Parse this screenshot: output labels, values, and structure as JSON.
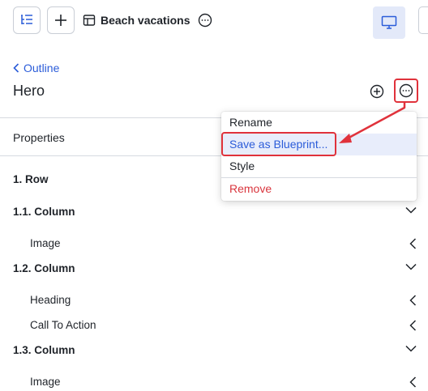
{
  "header": {
    "document_title": "Beach vacations",
    "icons": [
      "outline-tree-icon",
      "plus-icon",
      "template-icon",
      "more-icon",
      "desktop-icon"
    ]
  },
  "nav": {
    "back_label": "Outline"
  },
  "component": {
    "title": "Hero"
  },
  "section": {
    "properties_label": "Properties"
  },
  "tree": {
    "items": [
      {
        "label": "1. Row"
      },
      {
        "label": "1.1. Column"
      },
      {
        "label": "Image"
      },
      {
        "label": "1.2. Column"
      },
      {
        "label": "Heading"
      },
      {
        "label": "Call To Action"
      },
      {
        "label": "1.3. Column"
      },
      {
        "label": "Image"
      }
    ]
  },
  "context_menu": {
    "items": [
      {
        "label": "Rename"
      },
      {
        "label": "Save as Blueprint..."
      },
      {
        "label": "Style"
      },
      {
        "label": "Remove"
      }
    ]
  },
  "colors": {
    "accent": "#2b5cd9",
    "highlight_bg": "#e8edfb",
    "annotation_red": "#e0323b",
    "danger": "#d9363e"
  }
}
